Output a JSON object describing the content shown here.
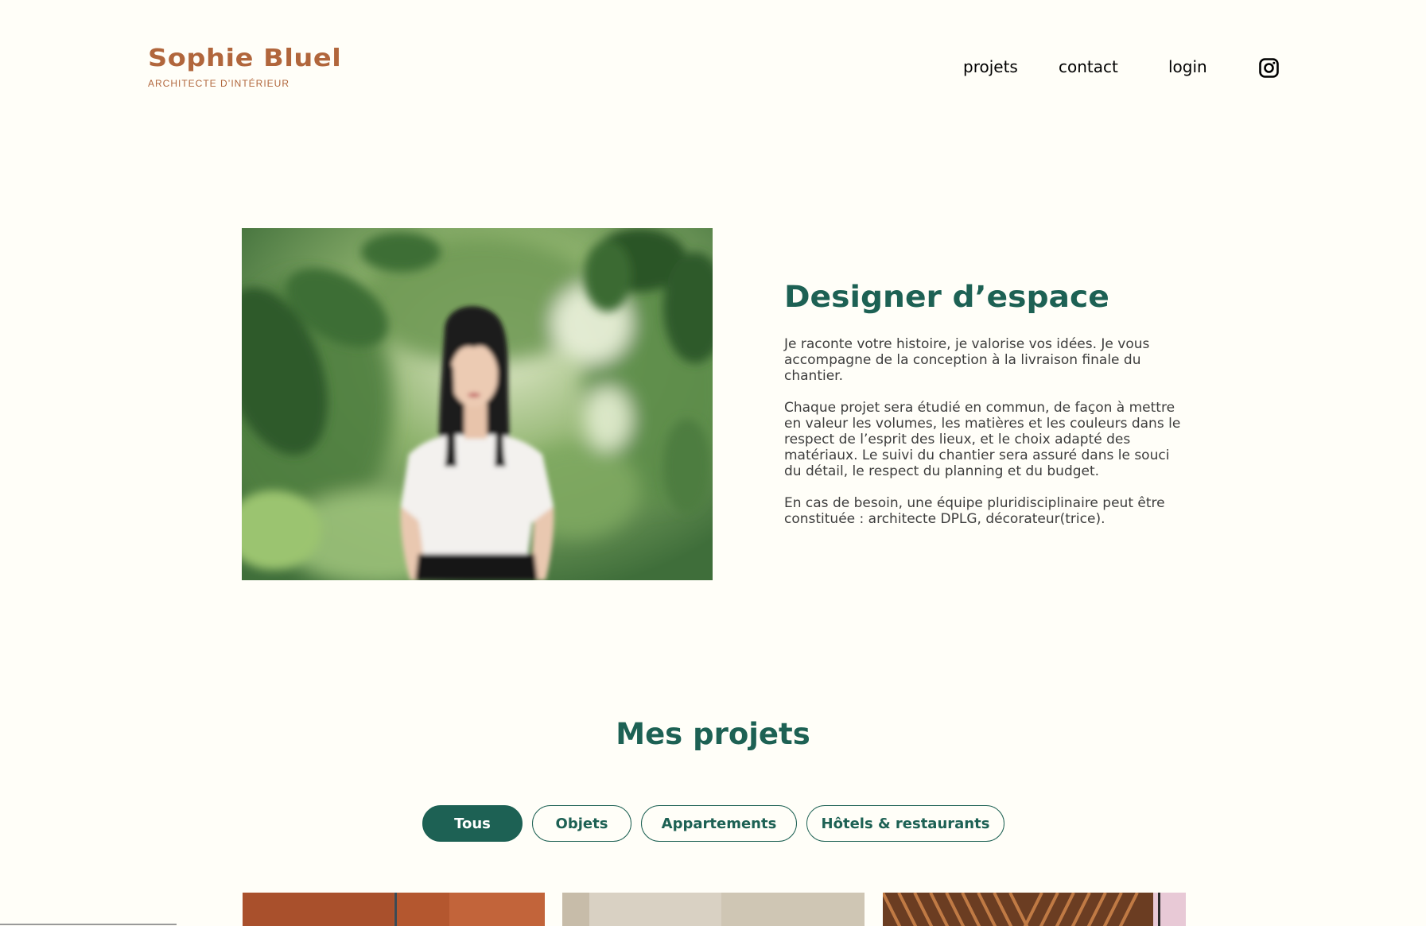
{
  "header": {
    "logo_name": "Sophie Bluel",
    "logo_subtitle": "ARCHITECTE D’INTÉRIEUR",
    "nav": [
      {
        "label": "projets"
      },
      {
        "label": "contact"
      },
      {
        "label": "login"
      }
    ],
    "social_icon": "instagram-icon"
  },
  "intro": {
    "title": "Designer d’espace",
    "paragraphs": [
      "Je raconte votre histoire, je valorise vos idées. Je vous accompagne de la conception à la livraison finale du chantier.",
      "Chaque projet sera étudié en commun, de façon à mettre en valeur les volumes, les matières et les couleurs dans le respect de l’esprit des lieux, et le choix adapté des matériaux. Le suivi du chantier sera assuré dans le souci du détail, le respect du planning et du budget.",
      "En cas de besoin, une équipe pluridisciplinaire peut être constituée : architecte DPLG, décorateur(trice)."
    ]
  },
  "projects": {
    "title": "Mes projets",
    "filters": [
      {
        "label": "Tous",
        "active": true
      },
      {
        "label": "Objets",
        "active": false
      },
      {
        "label": "Appartements",
        "active": false
      },
      {
        "label": "Hôtels & restaurants",
        "active": false
      }
    ]
  },
  "colors": {
    "background": "#FFFEF8",
    "brand_brown": "#B1663C",
    "brand_green": "#1D6154",
    "text": "#3D3D3D"
  }
}
